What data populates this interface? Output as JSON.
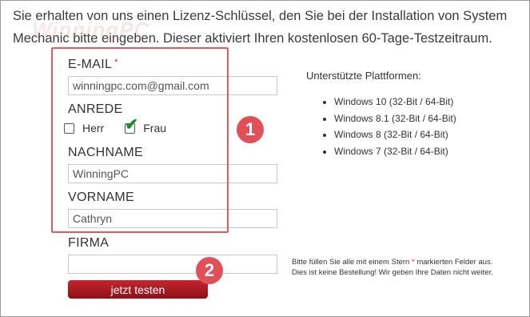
{
  "intro_text": "Sie erhalten von uns einen Lizenz-Schlüssel, den Sie bei der Installation von System Mechanic bitte eingeben. Dieser aktiviert Ihren kostenlosen 60-Tage-Testzeitraum.",
  "watermark": "WinningPC",
  "form": {
    "email": {
      "label": "E-MAIL",
      "required_mark": "*",
      "value": "winningpc.com@gmail.com"
    },
    "anrede": {
      "label": "ANREDE",
      "options": [
        {
          "label": "Herr",
          "checked": false
        },
        {
          "label": "Frau",
          "checked": true
        }
      ]
    },
    "nachname": {
      "label": "NACHNAME",
      "value": "WinningPC"
    },
    "vorname": {
      "label": "VORNAME",
      "value": "Cathryn"
    },
    "firma": {
      "label": "FIRMA",
      "value": ""
    },
    "submit_label": "jetzt testen"
  },
  "platforms": {
    "title": "Unterstützte Plattformen:",
    "items": [
      "Windows 10 (32-Bit / 64-Bit)",
      "Windows 8.1 (32-Bit / 64-Bit)",
      "Windows 8 (32-Bit / 64-Bit)",
      "Windows 7 (32-Bit / 64-Bit)"
    ]
  },
  "note": {
    "before": "Bitte füllen Sie alle mit einem Stern",
    "star": "*",
    "after": "markierten Felder aus.",
    "line2": "Dies ist keine Bestellung! Wir geben Ihre Daten nicht weiter."
  },
  "annotations": {
    "badge_1": "1",
    "badge_2": "2",
    "accent_color": "#e15056"
  }
}
